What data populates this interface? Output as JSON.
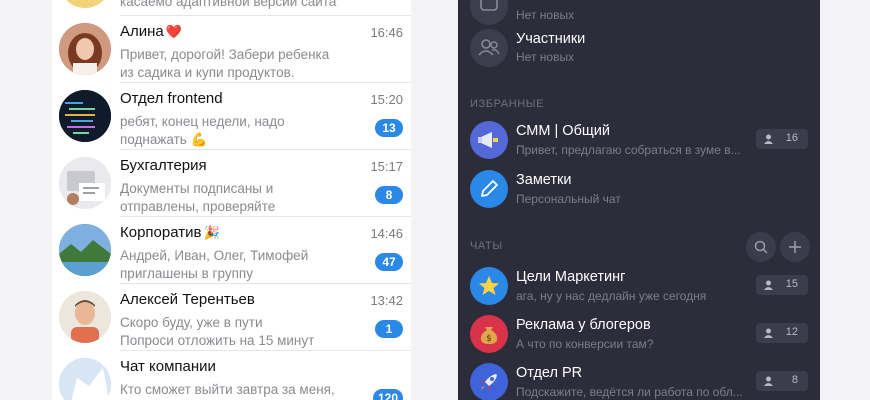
{
  "left_list": {
    "top_fragment": "касаемо адаптивной версии сайта",
    "chats": [
      {
        "name": "Алина",
        "emoji": "❤️",
        "time": "16:46",
        "lines": [
          "Привет, дорогой! Забери ребенка",
          "из садика и купи продуктов."
        ],
        "badge": ""
      },
      {
        "name": "Отдел frontend",
        "emoji": "",
        "time": "15:20",
        "lines": [
          "ребят, конец недели, надо",
          "поднажать 💪"
        ],
        "badge": "13"
      },
      {
        "name": "Бухгалтерия",
        "emoji": "",
        "time": "15:17",
        "lines": [
          "Документы подписаны и",
          "отправлены, проверяйте"
        ],
        "badge": "8"
      },
      {
        "name": "Корпоратив",
        "emoji": "🎉",
        "time": "14:46",
        "lines": [
          "Андрей, Иван, Олег, Тимофей",
          "приглашены в группу"
        ],
        "badge": "47"
      },
      {
        "name": "Алексей Терентьев",
        "emoji": "",
        "time": "13:42",
        "lines": [
          "Скоро буду, уже в пути",
          "Попроси отложить на 15 минут"
        ],
        "badge": "1"
      },
      {
        "name": "Чат компании",
        "emoji": "",
        "time": "",
        "lines": [
          "Кто сможет выйти завтра за меня,",
          ""
        ],
        "badge": "120"
      }
    ]
  },
  "right_panel": {
    "top_item": {
      "subtitle": "Нет новых"
    },
    "members_item": {
      "title": "Участники",
      "subtitle": "Нет новых"
    },
    "favorites_title": "ИЗБРАННЫЕ",
    "favorites": [
      {
        "name": "СММ | Общий",
        "sub": "Привет, предлагаю собраться в зуме в...",
        "members": "16",
        "color": "#5468d8"
      },
      {
        "name": "Заметки",
        "sub": "Персональный чат",
        "members": "",
        "color": "#2a88e6"
      }
    ],
    "chats_title": "ЧАТЫ",
    "chats": [
      {
        "name": "Цели Маркетинг",
        "sub": "ага, ну у нас дедлайн уже сегодня",
        "members": "15",
        "color": "#2a88e6"
      },
      {
        "name": "Реклама у блогеров",
        "sub": "А что по конверсии там?",
        "members": "12",
        "color": "#d8334a"
      },
      {
        "name": "Отдел PR",
        "sub": "Подскажите, ведётся ли работа по обл...",
        "members": "8",
        "color": "#3f63d8"
      }
    ]
  }
}
